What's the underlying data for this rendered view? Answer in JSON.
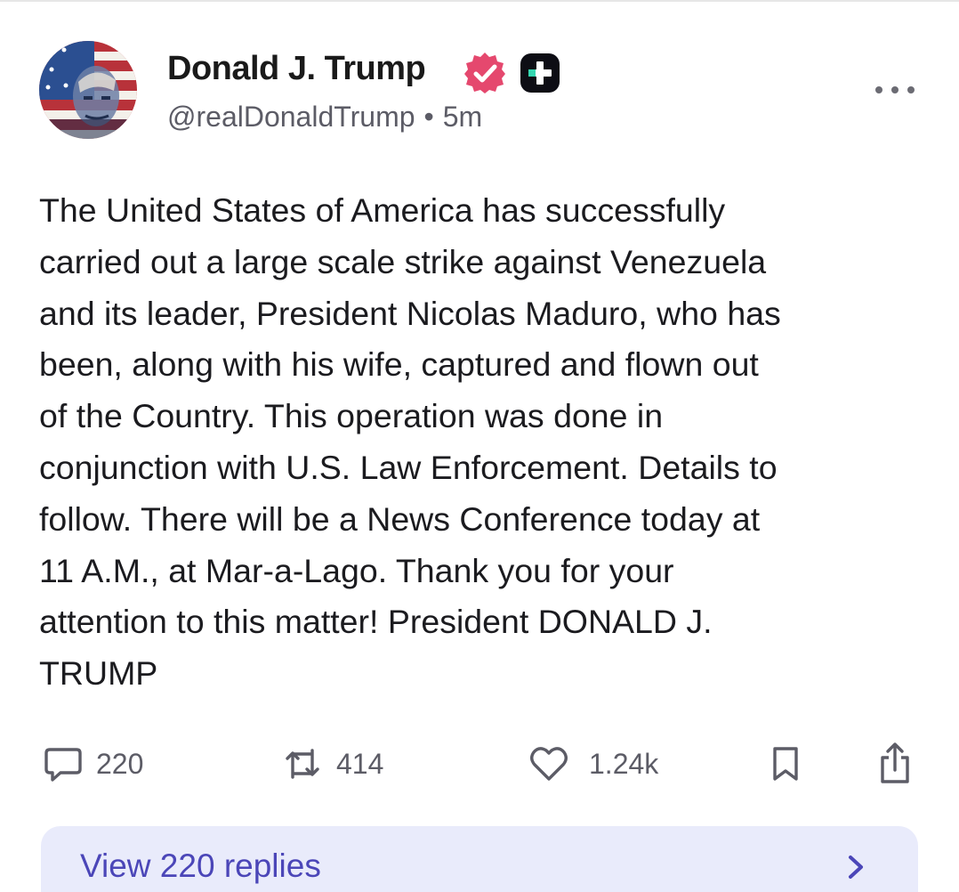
{
  "author": {
    "name": "Donald J. Trump",
    "handle": "@realDonaldTrump",
    "separator": "•",
    "time": "5m"
  },
  "post": {
    "text": "The United States of America has successfully\ncarried out a large scale strike against Venezuela\nand its leader, President Nicolas Maduro, who has\nbeen, along with his wife, captured and flown out\nof the Country. This operation was done in\nconjunction with U.S. Law Enforcement. Details to\nfollow. There will be a News Conference today at\n11 A.M., at Mar-a-Lago. Thank you for your\nattention to this matter! President DONALD J.\nTRUMP"
  },
  "actions": {
    "replies_count": "220",
    "retruths_count": "414",
    "likes_count": "1.24k"
  },
  "replies_bar": {
    "label": "View 220 replies"
  },
  "icons": {
    "verified": "verified-badge-icon",
    "plus": "plus-badge-icon",
    "more": "more-horizontal-icon",
    "reply": "speech-bubble-icon",
    "retruth": "repost-arrows-icon",
    "like": "heart-icon",
    "bookmark": "bookmark-icon",
    "share": "share-upload-icon",
    "chevron": "chevron-right-icon"
  },
  "colors": {
    "verified_badge": "#e5486e",
    "text_primary": "#1b1b1f",
    "text_secondary": "#5c5c66",
    "replies_bar_bg": "#e9ebfb",
    "replies_bar_text": "#4b46b8"
  }
}
